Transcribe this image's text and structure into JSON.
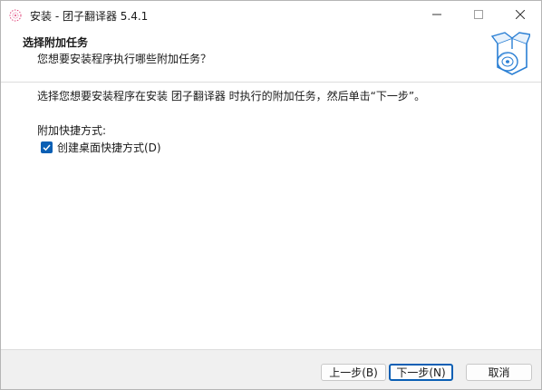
{
  "titlebar": {
    "title": "安装 - 团子翻译器 5.4.1",
    "app_icon": "flower-icon",
    "minimize_icon": "minimize-icon",
    "maximize_icon": "maximize-icon",
    "close_icon": "close-icon"
  },
  "header": {
    "title": "选择附加任务",
    "subtitle": "您想要安装程序执行哪些附加任务？",
    "image_icon": "installer-box-disc-icon"
  },
  "content": {
    "description": "选择您想要安装程序在安装 团子翻译器 时执行的附加任务，然后单击“下一步”。",
    "group_label": "附加快捷方式:",
    "tasks": [
      {
        "label": "创建桌面快捷方式(D)",
        "checked": true
      }
    ]
  },
  "buttons": {
    "back": "上一步(B)",
    "next": "下一步(N)",
    "cancel": "取消"
  },
  "colors": {
    "accent": "#0a5fb4"
  }
}
